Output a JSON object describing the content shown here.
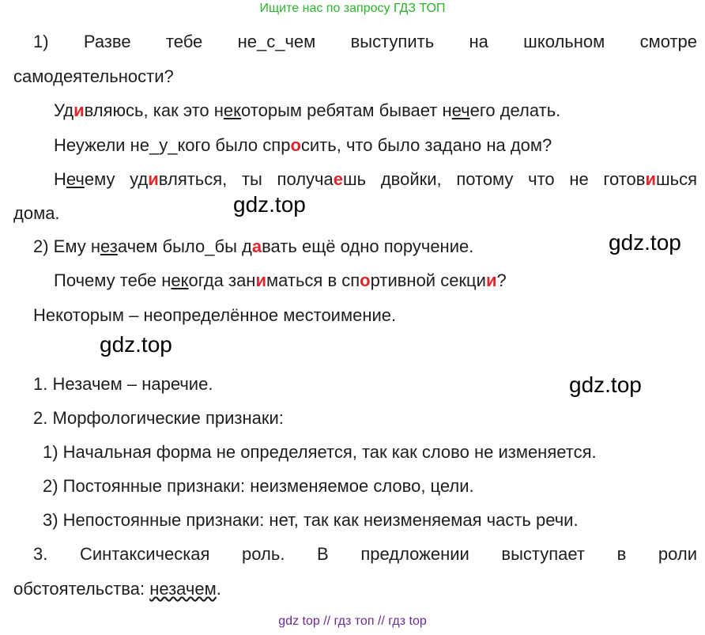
{
  "header": {
    "link": "Ищите нас по запросу ГДЗ ТОП"
  },
  "lines": {
    "l1": "1) Разве тебе не_с_чем выступить на школьном смотре",
    "l2": "самодеятельности?",
    "l3a": "Уд",
    "l3b": "и",
    "l3c": "вляюсь, как это н",
    "l3d": "ек",
    "l3e": "оторым ребятам бывает н",
    "l3f": "еч",
    "l3g": "его делать.",
    "l4a": "Неужели не_у_кого было спр",
    "l4b": "о",
    "l4c": "сить, что было задано на дом?",
    "l5a": "Н",
    "l5b": "еч",
    "l5c": "ему уд",
    "l5d": "и",
    "l5e": "вляться, ты получа",
    "l5f": "е",
    "l5g": "шь двойки, потому что не готов",
    "l5h": "и",
    "l5i": "шься",
    "l6": "дома.",
    "l7a": "2) Ему н",
    "l7b": "ез",
    "l7c": "ачем было_бы д",
    "l7d": "а",
    "l7e": "вать ещё одно поручение.",
    "l8a": "Почему тебе н",
    "l8b": "ек",
    "l8c": "огда зан",
    "l8d": "и",
    "l8e": "маться в сп",
    "l8f": "о",
    "l8g": "ртивной секци",
    "l8h": "и",
    "l8i": "?",
    "l9": "Некоторым – неопределённое местоимение.",
    "l10": "1. Незачем – наречие.",
    "l11": "2. Морфологические признаки:",
    "l12": "1) Начальная форма не определяется, так как слово не изменяется.",
    "l13": "2) Постоянные признаки: неизменяемое слово, цели.",
    "l14": "3) Непостоянные признаки: нет, так как неизменяемая часть речи.",
    "l15": "3. Синтаксическая роль. В предложении выступает в роли",
    "l16a": "обстоятельства: ",
    "l16b": "незачем",
    "l16c": "."
  },
  "watermarks": [
    "gdz.top",
    "gdz.top",
    "gdz.top",
    "gdz.top"
  ],
  "footer": {
    "link": "gdz top  //  гдз топ  //  гдз top"
  },
  "colors": {
    "header_link": "#2ab52a",
    "footer_link": "#6b2c91",
    "highlight": "#e0262c",
    "text": "#1e1e1e"
  }
}
